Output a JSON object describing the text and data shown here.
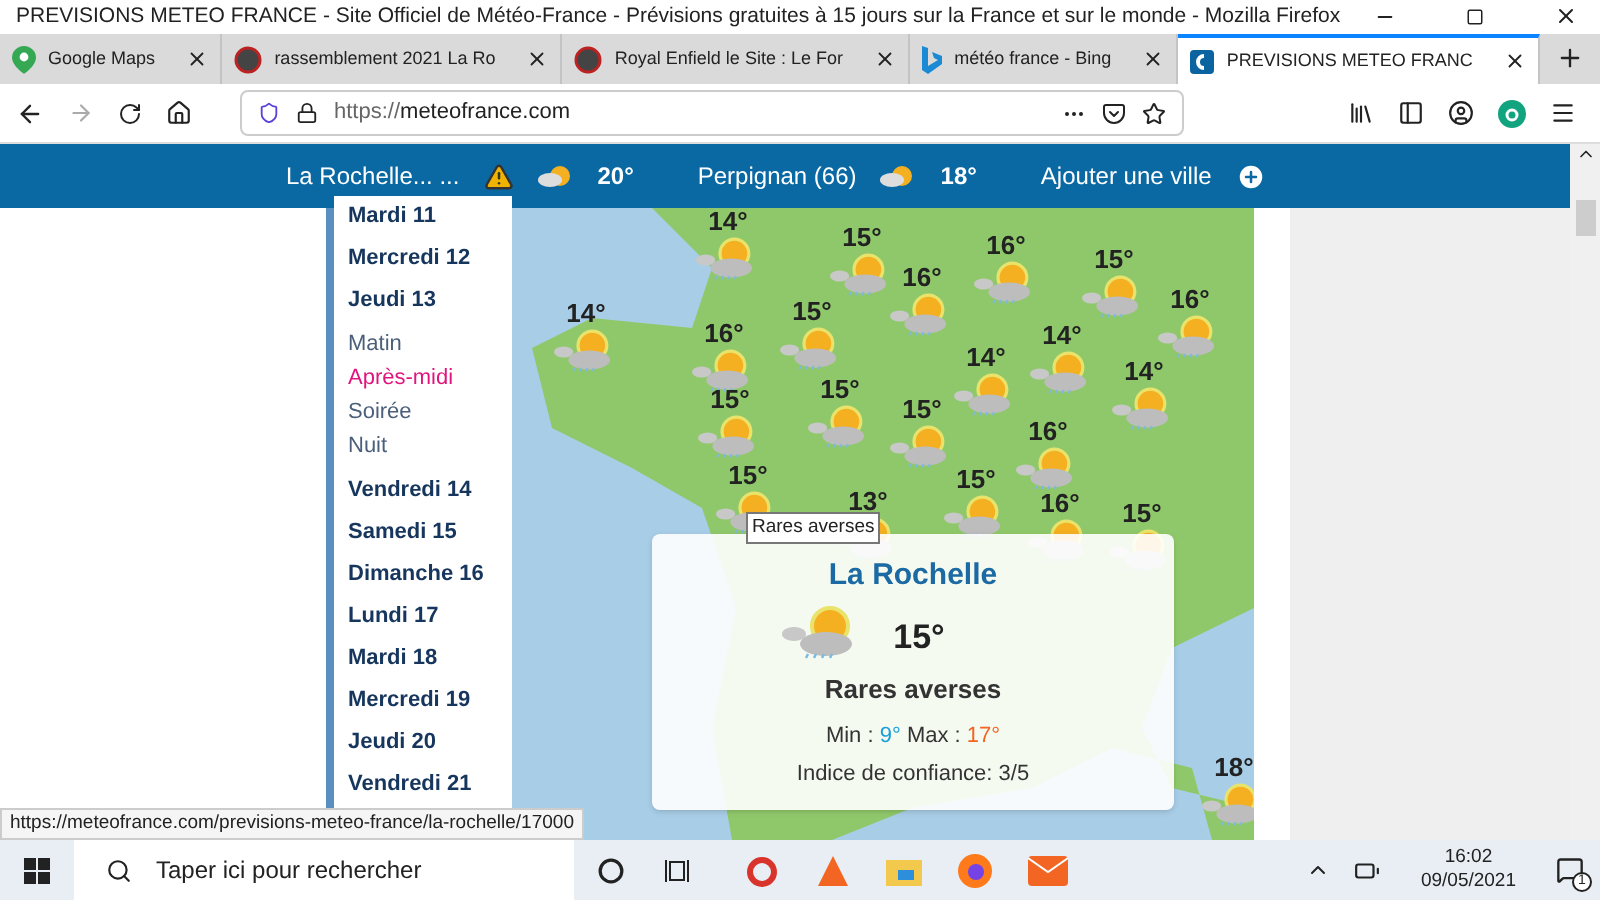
{
  "window": {
    "title": "PREVISIONS METEO FRANCE - Site Officiel de Météo-France - Prévisions gratuites à 15 jours sur la France et sur le monde - Mozilla Firefox"
  },
  "tabs": [
    {
      "label": "Google Maps",
      "selected": false,
      "kind": "maps"
    },
    {
      "label": "rassemblement 2021 La Ro",
      "selected": false,
      "kind": "moto"
    },
    {
      "label": "Royal Enfield le Site : Le For",
      "selected": false,
      "kind": "moto"
    },
    {
      "label": "météo france - Bing",
      "selected": false,
      "kind": "bing"
    },
    {
      "label": "PREVISIONS METEO FRANC",
      "selected": true,
      "kind": "meteo"
    }
  ],
  "address": {
    "prefix": "https://",
    "domain": "meteofrance.com"
  },
  "cities": [
    {
      "name": "La Rochelle... ...",
      "warning": true,
      "temp": "20°"
    },
    {
      "name": "Perpignan (66)",
      "warning": false,
      "temp": "18°"
    }
  ],
  "add_city": "Ajouter une ville",
  "days": [
    {
      "label": "Mardi 11",
      "kind": "day",
      "selected": false
    },
    {
      "label": "Mercredi 12",
      "kind": "day",
      "selected": false
    },
    {
      "label": "Jeudi 13",
      "kind": "day",
      "selected": false
    },
    {
      "label": "Matin",
      "kind": "period",
      "selected": false
    },
    {
      "label": "Après-midi",
      "kind": "period",
      "selected": true
    },
    {
      "label": "Soirée",
      "kind": "period",
      "selected": false
    },
    {
      "label": "Nuit",
      "kind": "period",
      "selected": false
    },
    {
      "label": "Vendredi 14",
      "kind": "day",
      "selected": false
    },
    {
      "label": "Samedi 15",
      "kind": "day",
      "selected": false
    },
    {
      "label": "Dimanche 16",
      "kind": "day",
      "selected": false
    },
    {
      "label": "Lundi 17",
      "kind": "day",
      "selected": false
    },
    {
      "label": "Mardi 18",
      "kind": "day",
      "selected": false
    },
    {
      "label": "Mercredi 19",
      "kind": "day",
      "selected": false
    },
    {
      "label": "Jeudi 20",
      "kind": "day",
      "selected": false
    },
    {
      "label": "Vendredi 21",
      "kind": "day",
      "selected": false
    }
  ],
  "map_markers": [
    {
      "temp": "14°"
    },
    {
      "temp": "15°"
    },
    {
      "temp": "16°"
    },
    {
      "temp": "14°"
    },
    {
      "temp": "16°"
    },
    {
      "temp": "15°"
    },
    {
      "temp": "15°"
    },
    {
      "temp": "15°"
    },
    {
      "temp": "15°"
    },
    {
      "temp": "15°"
    },
    {
      "temp": "13°"
    },
    {
      "temp": "16°"
    },
    {
      "temp": "15°"
    },
    {
      "temp": "16°"
    },
    {
      "temp": "14°"
    },
    {
      "temp": "14°"
    },
    {
      "temp": "14°"
    },
    {
      "temp": "16°"
    },
    {
      "temp": "15°"
    },
    {
      "temp": "16°"
    },
    {
      "temp": "15°"
    },
    {
      "temp": "18°"
    }
  ],
  "popup": {
    "city": "La Rochelle",
    "temp": "15°",
    "condition": "Rares averses",
    "min_label": "Min :",
    "min": "9°",
    "max_label": "Max :",
    "max": "17°",
    "confidence": "Indice de confiance: 3/5"
  },
  "tooltip": "Rares averses",
  "status_url": "https://meteofrance.com/previsions-meteo-france/la-rochelle/17000",
  "taskbar": {
    "search_placeholder": "Taper ici pour rechercher",
    "time": "16:02",
    "date": "09/05/2021",
    "notifications": "1"
  }
}
